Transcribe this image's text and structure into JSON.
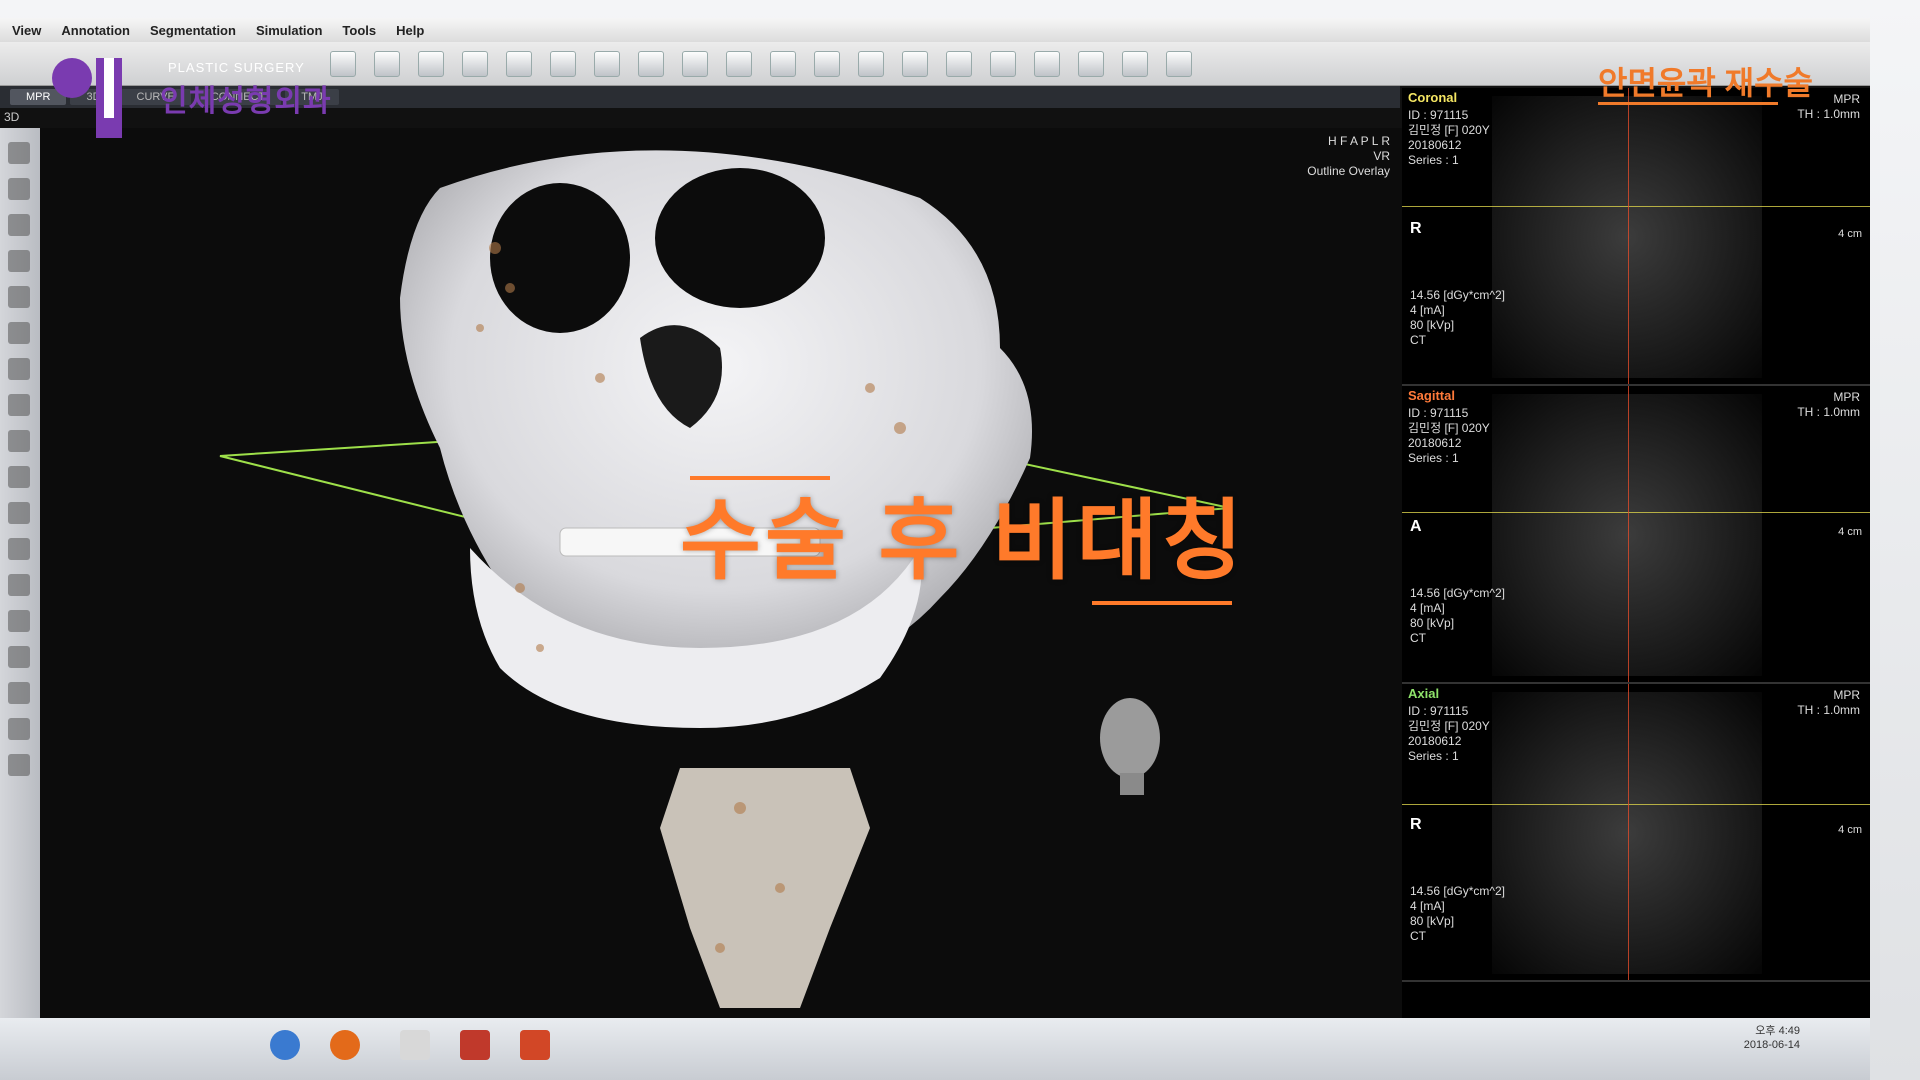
{
  "menu": {
    "items": [
      "View",
      "Annotation",
      "Segmentation",
      "Simulation",
      "Tools",
      "Help"
    ]
  },
  "tabs": [
    "MPR",
    "3D",
    "CURVE",
    "CONNECT",
    "TMJ"
  ],
  "view3d_label": "3D",
  "viewport": {
    "info_lines": [
      "H F A P L R",
      "VR",
      "Outline Overlay"
    ]
  },
  "panels": {
    "coronal": {
      "title": "Coronal",
      "title_color": "#f5e663",
      "meta": "ID : 971115\n김민정 [F] 020Y\n20180612\nSeries : 1",
      "dose": "14.56 [dGy*cm^2]\n4 [mA]\n80 [kVp]\nCT",
      "mpr": "MPR\nTH : 1.0mm",
      "orient": "R",
      "scale": "4 cm"
    },
    "sagittal": {
      "title": "Sagittal",
      "title_color": "#ff7a3a",
      "meta": "ID : 971115\n김민정 [F] 020Y\n20180612\nSeries : 1",
      "dose": "14.56 [dGy*cm^2]\n4 [mA]\n80 [kVp]\nCT",
      "mpr": "MPR\nTH : 1.0mm",
      "orient": "A",
      "scale": "4 cm"
    },
    "axial": {
      "title": "Axial",
      "title_color": "#8ee36a",
      "meta": "ID : 971115\n김민정 [F] 020Y\n20180612\nSeries : 1",
      "dose": "14.56 [dGy*cm^2]\n4 [mA]\n80 [kVp]\nCT",
      "mpr": "MPR\nTH : 1.0mm",
      "orient": "R",
      "scale": "4 cm"
    }
  },
  "taskbar": {
    "time": "오후 4:49",
    "date": "2018-06-14"
  },
  "overlay": {
    "logo_sub": "PLASTIC SURGERY",
    "logo_main": "인체성형외과",
    "corner_title": "안면윤곽 재수술",
    "caption": "수술 후 비대칭"
  },
  "colors": {
    "accent_orange": "#ff7a2a",
    "logo_purple": "#7a3bb0"
  }
}
